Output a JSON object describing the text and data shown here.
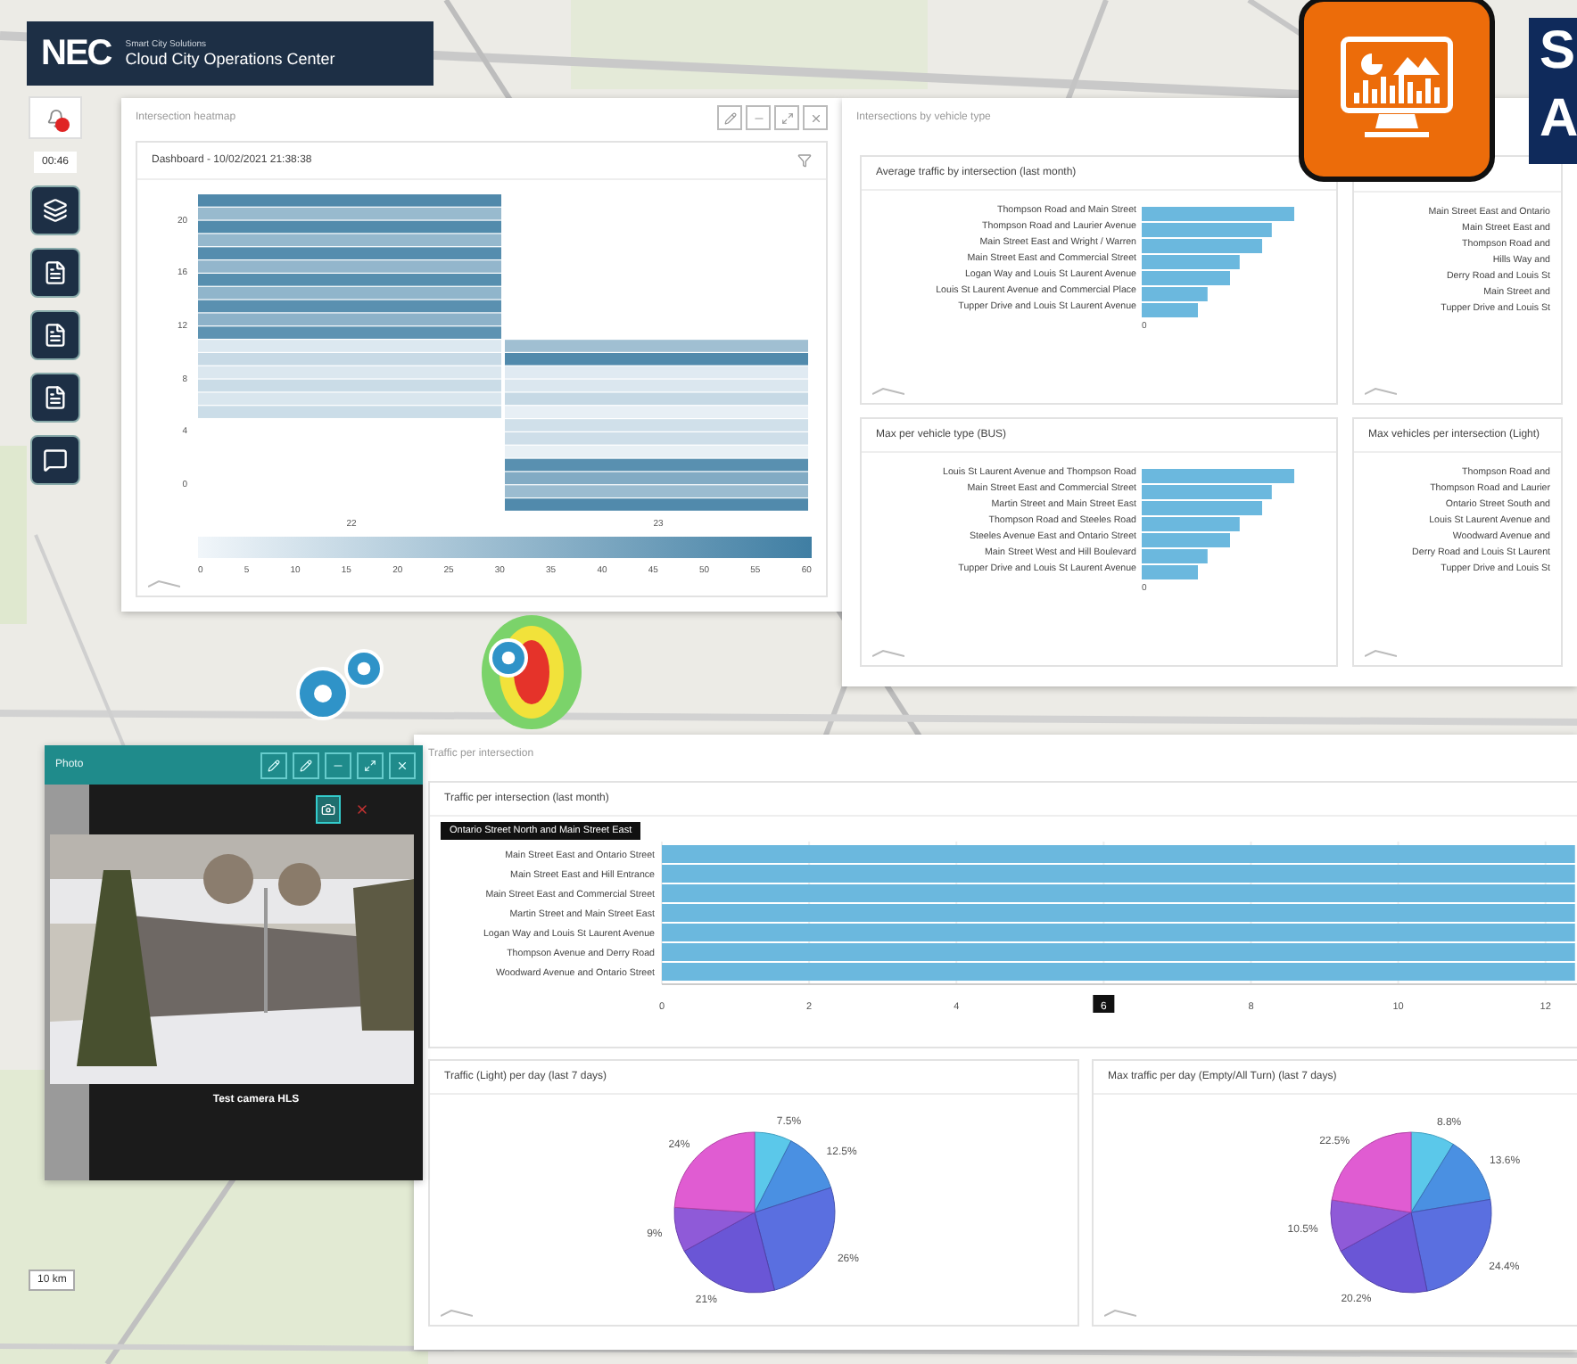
{
  "header": {
    "brand": "NEC",
    "subtitle": "Smart City Solutions",
    "title": "Cloud City Operations Center"
  },
  "sidebar": {
    "time": "00:46",
    "tools": [
      {
        "kind": "layers"
      },
      {
        "kind": "report"
      },
      {
        "kind": "report"
      },
      {
        "kind": "report"
      },
      {
        "kind": "chat"
      }
    ]
  },
  "heatmap_panel": {
    "title": "Intersection heatmap",
    "card_title": "Dashboard - 10/02/2021 21:38:38",
    "yticks": [
      "20",
      "16",
      "12",
      "8",
      "4",
      "0"
    ],
    "columns": [
      "22",
      "23"
    ],
    "scale_ticks": [
      "0",
      "5",
      "10",
      "15",
      "20",
      "25",
      "30",
      "35",
      "40",
      "45",
      "50",
      "55",
      "60"
    ]
  },
  "analytics_panel": {
    "title": "Intersections by vehicle type",
    "charts": [
      {
        "title": "Average traffic by intersection (last month)",
        "labels": [
          "Thompson Road and Main Street",
          "Thompson Road and Laurier Avenue",
          "Main Street East and Wright / Warren",
          "Main Street East and Commercial Street",
          "Logan Way and Louis St Laurent Avenue",
          "Louis St Laurent Avenue and Commercial Place",
          "Tupper Drive and Louis St Laurent Avenue"
        ],
        "axis": "0"
      },
      {
        "labels": [
          "Main Street East and Ontario",
          "Main Street East and",
          "Thompson Road and",
          "Hills Way and",
          "Derry Road and Louis St",
          "Main Street and",
          "Tupper Drive and Louis St"
        ]
      },
      {
        "title": "Max per vehicle type (BUS)",
        "labels": [
          "Louis St Laurent Avenue and Thompson Road",
          "Main Street East and Commercial Street",
          "Martin Street and Main Street East",
          "Thompson Road and Steeles Road",
          "Steeles Avenue East and Ontario Street",
          "Main Street West and Hill Boulevard",
          "Tupper Drive and Louis St Laurent Avenue"
        ],
        "axis": "0"
      },
      {
        "title": "Max vehicles per intersection (Light)",
        "labels": [
          "Thompson Road and",
          "Thompson Road and Laurier",
          "Ontario Street South and",
          "Louis St Laurent Avenue and",
          "Woodward Avenue and",
          "Derry Road and Louis St Laurent",
          "Tupper Drive and Louis St"
        ]
      }
    ]
  },
  "banner": {
    "letters": [
      "S",
      "A"
    ]
  },
  "camera": {
    "title": "Photo",
    "caption": "Test camera HLS"
  },
  "traffic_panel": {
    "title": "Traffic per intersection",
    "bar_chart": {
      "title": "Traffic per intersection (last month)",
      "tooltip": "Ontario Street North and Main Street East",
      "pointer": "6",
      "chart_data": {
        "type": "bar",
        "orientation": "horizontal",
        "categories": [
          "Main Street East and Ontario Street",
          "Main Street East and Hill Entrance",
          "Main Street East and Commercial Street",
          "Martin Street and Main Street East",
          "Logan Way and Louis St Laurent Avenue",
          "Thompson Avenue and Derry Road",
          "Woodward Avenue and Ontario Street"
        ],
        "values": [
          12.4,
          12.4,
          12.4,
          12.4,
          12.4,
          12.4,
          12.4
        ],
        "xlim": [
          0,
          12.5
        ],
        "xticks": [
          0,
          2,
          4,
          6,
          8,
          10,
          12
        ],
        "grid": true
      }
    },
    "pies": [
      {
        "title": "Traffic (Light) per day (last 7 days)",
        "chart_data": {
          "type": "pie",
          "series": [
            {
              "values": [
                7.5,
                12.5,
                26,
                21,
                9,
                24
              ]
            }
          ],
          "value_labels": [
            "7.5%",
            "12.5%",
            "26%",
            "21%",
            "9%",
            "24%"
          ]
        }
      },
      {
        "title": "Max traffic per day (Empty/All Turn) (last 7 days)",
        "chart_data": {
          "type": "pie",
          "series": [
            {
              "values": [
                8.8,
                13.6,
                24.4,
                20.2,
                10.5,
                22.5
              ]
            }
          ],
          "value_labels": [
            "8.8%",
            "13.6%",
            "24.4%",
            "20.2%",
            "10.5%",
            "22.5%"
          ]
        }
      }
    ]
  },
  "scale": "10 km"
}
